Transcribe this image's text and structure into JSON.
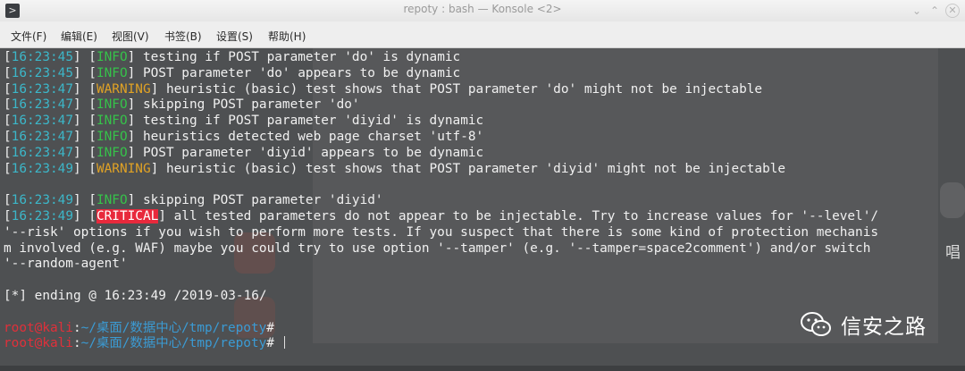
{
  "window": {
    "title": "repoty : bash — Konsole <2>",
    "icon": "terminal-icon",
    "controls": [
      "minimize-icon",
      "maximize-icon",
      "close-icon"
    ]
  },
  "menu": [
    {
      "label": "文件(F)"
    },
    {
      "label": "编辑(E)"
    },
    {
      "label": "视图(V)"
    },
    {
      "label": "书签(B)"
    },
    {
      "label": "设置(S)"
    },
    {
      "label": "帮助(H)"
    }
  ],
  "log": [
    {
      "time": "16:23:45",
      "level": "INFO",
      "message": " testing if POST parameter 'do' is dynamic"
    },
    {
      "time": "16:23:45",
      "level": "INFO",
      "message": " POST parameter 'do' appears to be dynamic"
    },
    {
      "time": "16:23:47",
      "level": "WARNING",
      "message": " heuristic (basic) test shows that POST parameter 'do' might not be injectable"
    },
    {
      "time": "16:23:47",
      "level": "INFO",
      "message": " skipping POST parameter 'do'"
    },
    {
      "time": "16:23:47",
      "level": "INFO",
      "message": " testing if POST parameter 'diyid' is dynamic"
    },
    {
      "time": "16:23:47",
      "level": "INFO",
      "message": " heuristics detected web page charset 'utf-8'"
    },
    {
      "time": "16:23:47",
      "level": "INFO",
      "message": " POST parameter 'diyid' appears to be dynamic"
    },
    {
      "time": "16:23:49",
      "level": "WARNING",
      "message": " heuristic (basic) test shows that POST parameter 'diyid' might not be injectable"
    },
    {
      "blank": true
    },
    {
      "time": "16:23:49",
      "level": "INFO",
      "message": " skipping POST parameter 'diyid'"
    },
    {
      "time": "16:23:49",
      "level": "CRITICAL",
      "message": " all tested parameters do not appear to be injectable. Try to increase values for '--level'/"
    },
    {
      "text": "'--risk' options if you wish to perform more tests. If you suspect that there is some kind of protection mechanis"
    },
    {
      "text": "m involved (e.g. WAF) maybe you could try to use option '--tamper' (e.g. '--tamper=space2comment') and/or switch"
    },
    {
      "text": "'--random-agent'"
    },
    {
      "blank": true
    },
    {
      "text": "[*] ending @ 16:23:49 /2019-03-16/"
    },
    {
      "blank": true
    },
    {
      "prompt": {
        "user": "root@kali",
        "sep": ":",
        "path": "~/桌面/数据中心/tmp/repoty",
        "symbol": "#",
        "cmd": ""
      }
    },
    {
      "prompt": {
        "user": "root@kali",
        "sep": ":",
        "path": "~/桌面/数据中心/tmp/repoty",
        "symbol": "#",
        "cmd": " ",
        "cursor": true
      }
    }
  ],
  "colors": {
    "timestamp": "#3cb7c9",
    "info": "#36c24a",
    "warning": "#e0a225",
    "critical_bg": "#e8293c",
    "prompt_user": "#e0303a",
    "prompt_path": "#3b9bd4"
  },
  "watermark": {
    "icon": "wechat-icon",
    "text": "信安之路"
  },
  "side_glyph": "唱"
}
